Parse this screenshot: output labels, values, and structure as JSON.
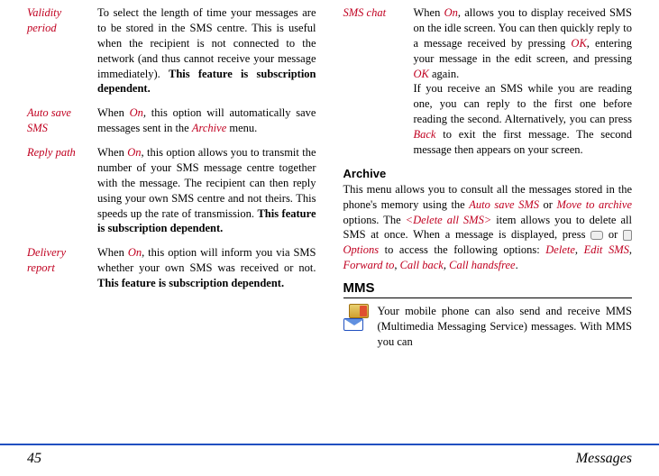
{
  "left": {
    "validity": {
      "term": "Validity period",
      "t1": "To select the length of time your messages are to be stored in the SMS centre. This is useful when the recipient is not connected to the network (and thus cannot receive your message immediately). ",
      "bold": "This feature is subscription dependent."
    },
    "autosave": {
      "term": "Auto save SMS",
      "t1": "When ",
      "on": "On",
      "t2": ", this option will automatically save messages sent in the ",
      "arch": "Archive",
      "t3": " menu."
    },
    "reply": {
      "term": "Reply path",
      "t1": "When ",
      "on": "On",
      "t2": ", this option allows you to transmit the number of your SMS message centre together with the message. The recipient can then reply using your own SMS centre and not theirs. This speeds up the rate of transmission. ",
      "bold": "This feature is subscription dependent."
    },
    "delivery": {
      "term": "Delivery report",
      "t1": "When ",
      "on": "On",
      "t2": ", this option will inform you via SMS whether your own SMS was received or not. ",
      "bold": "This feature is subscription dependent."
    }
  },
  "right": {
    "smschat": {
      "term": "SMS chat",
      "t1": "When ",
      "on": "On",
      "t2": ", allows you to display received SMS on the idle screen. You can then quickly reply to a message received by pressing ",
      "ok1": "OK",
      "t3": ", entering your message in the edit screen, and pressing ",
      "ok2": "OK",
      "t4": " again.",
      "t5": "If you receive an SMS while you are reading one, you can reply to the first one before reading the second. Alternatively, you can press ",
      "back": "Back",
      "t6": " to exit the first message. The second message then appears on your screen."
    },
    "archive": {
      "head": "Archive",
      "t1": "This menu allows you to consult all the messages stored in the phone's memory using the ",
      "auto": "Auto save SMS",
      "t2": " or ",
      "move": "Move to archive",
      "t3": " options. The ",
      "del": "<Delete all SMS>",
      "t4": " item allows you to delete all SMS at once. When a message is displayed, press ",
      "or": " or ",
      "opt": "Options",
      "t5": " to access the following options: ",
      "o1": "Delete",
      "c1": ", ",
      "o2": "Edit SMS",
      "c2": ", ",
      "o3": "Forward to",
      "c3": ", ",
      "o4": "Call back",
      "c4": ", ",
      "o5": "Call handsfree",
      "dot": "."
    },
    "mms": {
      "head": "MMS",
      "body": "Your mobile phone can also send and receive MMS (Multimedia Messaging Service) messages. With MMS you can"
    }
  },
  "footer": {
    "page": "45",
    "title": "Messages"
  }
}
